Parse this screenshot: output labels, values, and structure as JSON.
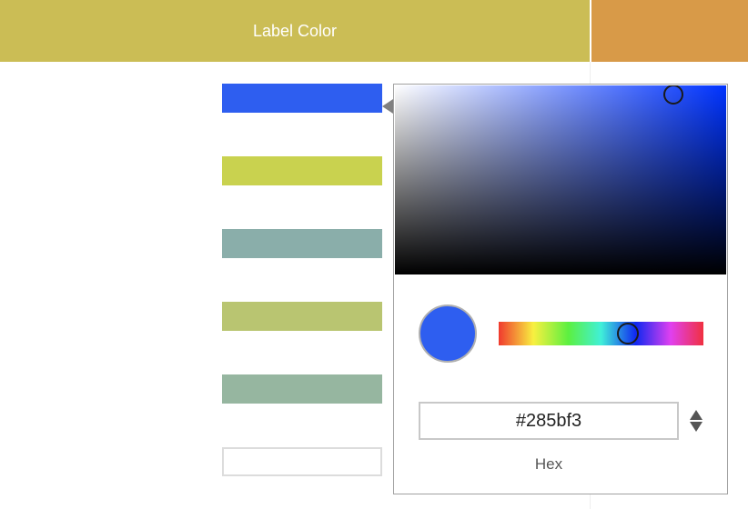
{
  "header": {
    "title": "Label Color",
    "color": "#cbbd55",
    "right_color": "#d89a48"
  },
  "swatches": [
    {
      "color": "#2e5ef0",
      "selected": true
    },
    {
      "color": "#c9d24f"
    },
    {
      "color": "#8aaeaa"
    },
    {
      "color": "#b9c571"
    },
    {
      "color": "#96b6a0"
    },
    {
      "color": "#ffffff",
      "empty": true
    }
  ],
  "picker": {
    "hex_value": "#285bf3",
    "mode_label": "Hex",
    "current_color": "#2e5ef0",
    "hue_color": "#0033ff",
    "saturation": 0.84,
    "brightness": 0.95,
    "hue_fraction": 0.63
  }
}
